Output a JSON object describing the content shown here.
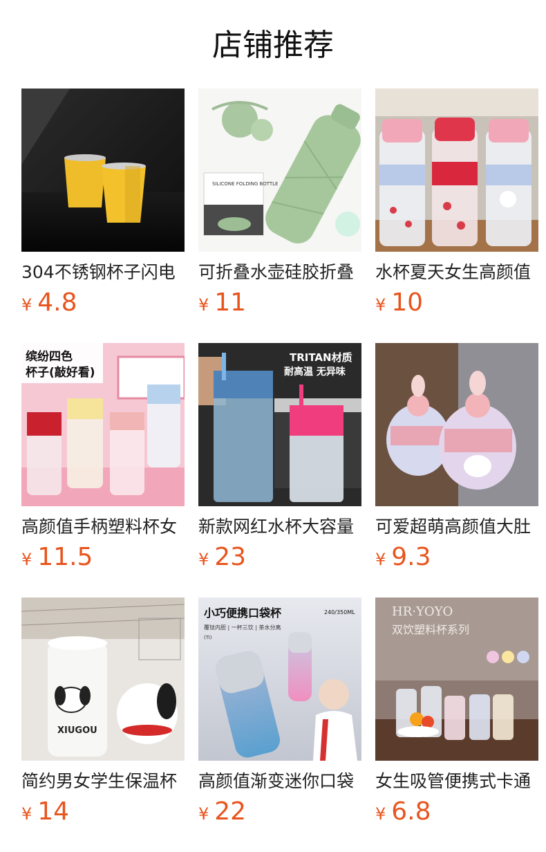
{
  "header": {
    "title": "店铺推荐"
  },
  "currency_symbol": "¥",
  "products": [
    {
      "name": "304不锈钢杯子闪电",
      "price": "4.8"
    },
    {
      "name": "可折叠水壶硅胶折叠",
      "price": "11"
    },
    {
      "name": "水杯夏天女生高颜值",
      "price": "10"
    },
    {
      "name": "高颜值手柄塑料杯女",
      "price": "11.5"
    },
    {
      "name": "新款网红水杯大容量",
      "price": "23"
    },
    {
      "name": "可爱超萌高颜值大肚",
      "price": "9.3"
    },
    {
      "name": "简约男女学生保温杯",
      "price": "14"
    },
    {
      "name": "高颜值渐变迷你口袋",
      "price": "22"
    },
    {
      "name": "女生吸管便携式卡通",
      "price": "6.8"
    }
  ],
  "image_texts": {
    "p2_box": "SILICONE FOLDING BOTTLE",
    "p4_overlay_line1": "缤纷四色",
    "p4_overlay_line2": "杯子(敲好看)",
    "p5_overlay_line1": "TRITAN材质",
    "p5_overlay_line2": "耐高温 无异味",
    "p7_text": "XIUGOU",
    "p8_title": "小巧便携口袋杯",
    "p8_capacity": "240/350ML",
    "p8_sub": "覆钛内胆 | 一杯三饮 | 茶水分离",
    "p8_ti": "(Ti)",
    "p9_brand": "HR·YOYO",
    "p9_series": "双饮塑料杯系列"
  },
  "colors": {
    "price": "#e8541d",
    "text": "#222222"
  }
}
